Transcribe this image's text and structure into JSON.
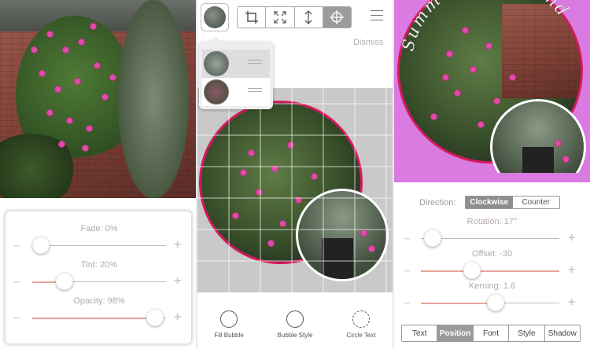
{
  "panel1": {
    "sliders": [
      {
        "label": "Fade: 0%",
        "value": 0
      },
      {
        "label": "Tint: 20%",
        "value": 0.2
      },
      {
        "label": "Opacity: 98%",
        "value": 0.98
      }
    ]
  },
  "panel2": {
    "toolbar": {
      "buttons": [
        "crop-icon",
        "expand-icon",
        "vertical-resize-icon",
        "crosshair-icon"
      ],
      "active_index": 3
    },
    "dismiss_label": "Dismiss",
    "bottom_tools": [
      {
        "icon": "fill-bubble-icon",
        "label": "Fill Bubble"
      },
      {
        "icon": "bubble-style-icon",
        "label": "Bubble Style"
      },
      {
        "icon": "circle-text-icon",
        "label": "Circle Text"
      }
    ]
  },
  "panel3": {
    "circle_text": "Summer in Oakland",
    "direction_label": "Direction:",
    "direction_options": [
      "Clockwise",
      "Counter"
    ],
    "direction_selected": "Clockwise",
    "sliders": [
      {
        "label": "Rotation: 17°",
        "value": 0.1
      },
      {
        "label": "Offset: -30",
        "value": 0.37
      },
      {
        "label": "Kerning: 1.6",
        "value": 0.53
      }
    ],
    "tabs": [
      "Text",
      "Position",
      "Font",
      "Style",
      "Shadow"
    ],
    "active_tab": "Position"
  },
  "colors": {
    "accent_pink": "#d41a5a",
    "photo_bg_purple": "#d97be0",
    "slider_fill": "#e9a39a"
  }
}
